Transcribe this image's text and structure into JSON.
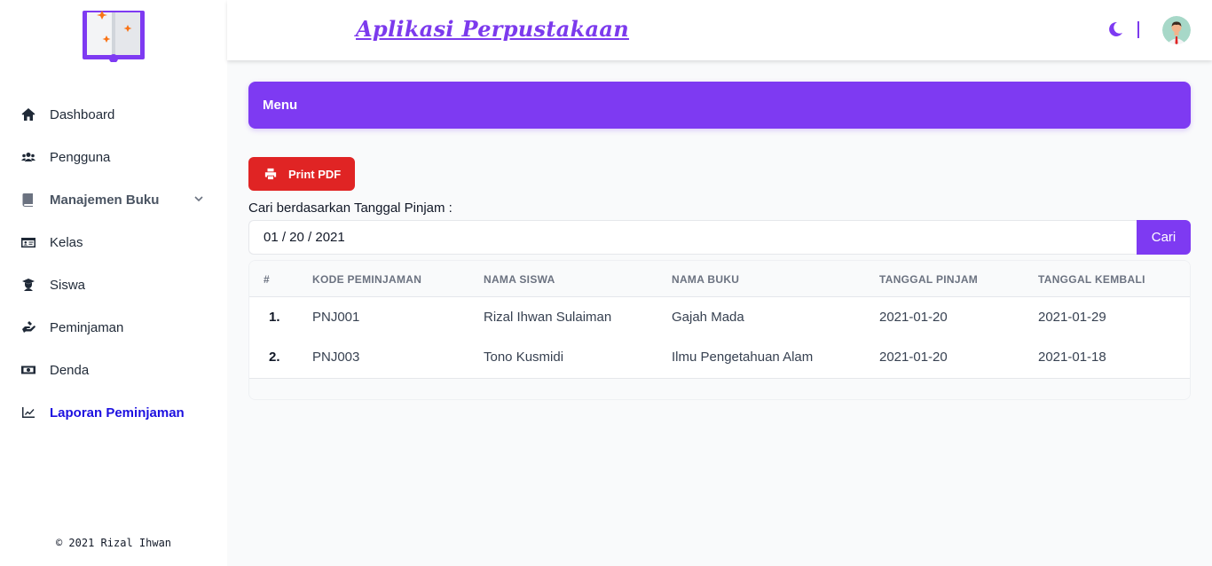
{
  "header": {
    "app_title": "Aplikasi Perpustakaan",
    "theme_icon": "moon-icon",
    "avatar_icon": "user-avatar"
  },
  "sidebar": {
    "logo_icon": "book-logo",
    "items": [
      {
        "label": "Dashboard",
        "icon": "home-icon"
      },
      {
        "label": "Pengguna",
        "icon": "users-icon"
      },
      {
        "label": "Manajemen Buku",
        "icon": "book-icon"
      },
      {
        "label": "Kelas",
        "icon": "id-card-icon"
      },
      {
        "label": "Siswa",
        "icon": "graduate-icon"
      },
      {
        "label": "Peminjaman",
        "icon": "hand-holding-icon"
      },
      {
        "label": "Denda",
        "icon": "money-icon"
      },
      {
        "label": "Laporan Peminjaman",
        "icon": "chart-line-icon"
      }
    ],
    "footer": "© 2021 Rizal Ihwan"
  },
  "main": {
    "menu_title": "Menu",
    "print_label": "Print PDF",
    "search_label": "Cari berdasarkan Tanggal Pinjam :",
    "date_value": "01 / 20 / 2021",
    "search_button": "Cari",
    "colors": {
      "accent": "#7e3af2",
      "danger": "#e02424",
      "active": "#1d10e0"
    },
    "table": {
      "headers": [
        "#",
        "KODE PEMINJAMAN",
        "NAMA SISWA",
        "NAMA BUKU",
        "TANGGAL PINJAM",
        "TANGGAL KEMBALI"
      ],
      "rows": [
        [
          "1.",
          "PNJ001",
          "Rizal Ihwan Sulaiman",
          "Gajah Mada",
          "2021-01-20",
          "2021-01-29"
        ],
        [
          "2.",
          "PNJ003",
          "Tono Kusmidi",
          "Ilmu Pengetahuan Alam",
          "2021-01-20",
          "2021-01-18"
        ]
      ]
    }
  }
}
